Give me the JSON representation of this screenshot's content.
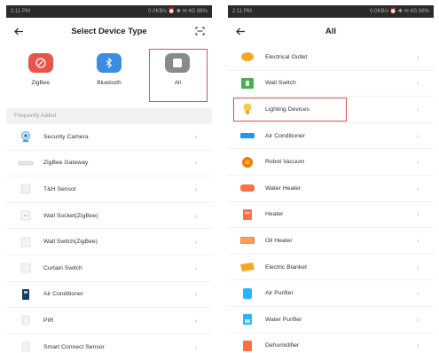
{
  "left": {
    "status_left": "2:11 PM",
    "status_right": "0.0KB/s ⏰ ✱ ✉ 4G 88%",
    "title": "Select Device Type",
    "categories": [
      {
        "label": "ZigBee",
        "icon": "zigbee-icon",
        "color": "#e8534a"
      },
      {
        "label": "Bluetooth",
        "icon": "bluetooth-icon",
        "color": "#3b8de0"
      },
      {
        "label": "All",
        "icon": "all-icon",
        "color": "#8a8a8a"
      }
    ],
    "section_header": "Frequently Added",
    "items": [
      {
        "label": "Security Camera",
        "icon": "security-camera-icon"
      },
      {
        "label": "ZigBee Gateway",
        "icon": "gateway-icon"
      },
      {
        "label": "T&H Sensor",
        "icon": "th-sensor-icon"
      },
      {
        "label": "Wall Socket(ZigBee)",
        "icon": "wall-socket-icon"
      },
      {
        "label": "Wall Switch(ZigBee)",
        "icon": "wall-switch-zigbee-icon"
      },
      {
        "label": "Curtain Switch",
        "icon": "curtain-switch-icon"
      },
      {
        "label": "Air Conditioner",
        "icon": "air-conditioner-remote-icon"
      },
      {
        "label": "PIR",
        "icon": "pir-icon"
      },
      {
        "label": "Smart Connect Sensor",
        "icon": "connect-sensor-icon"
      }
    ]
  },
  "right": {
    "status_left": "2:11 PM",
    "status_right": "0.0KB/s ⏰ ✱ ✉ 4G 88%",
    "title": "All",
    "items": [
      {
        "label": "Electrical Outlet",
        "icon": "electrical-outlet-icon",
        "color": "#f5a623"
      },
      {
        "label": "Wall Switch",
        "icon": "wall-switch-icon",
        "color": "#4caf50"
      },
      {
        "label": "Lighting Devices",
        "icon": "light-bulb-icon",
        "color": "#f7c948"
      },
      {
        "label": "Air Conditioner",
        "icon": "air-conditioner-icon",
        "color": "#2196f3"
      },
      {
        "label": "Robot Vacuum",
        "icon": "robot-vacuum-icon",
        "color": "#f57c00"
      },
      {
        "label": "Water Heater",
        "icon": "water-heater-icon",
        "color": "#ff7043"
      },
      {
        "label": "Heater",
        "icon": "heater-icon",
        "color": "#ff7043"
      },
      {
        "label": "Oil Heater",
        "icon": "oil-heater-icon",
        "color": "#ff8a3d"
      },
      {
        "label": "Electric Blanket",
        "icon": "electric-blanket-icon",
        "color": "#f5a623"
      },
      {
        "label": "Air Purifier",
        "icon": "air-purifier-icon",
        "color": "#29b6f6"
      },
      {
        "label": "Water Purifier",
        "icon": "water-purifier-icon",
        "color": "#29b6f6"
      },
      {
        "label": "Dehumidifier",
        "icon": "dehumidifier-icon",
        "color": "#ff7043"
      }
    ]
  }
}
